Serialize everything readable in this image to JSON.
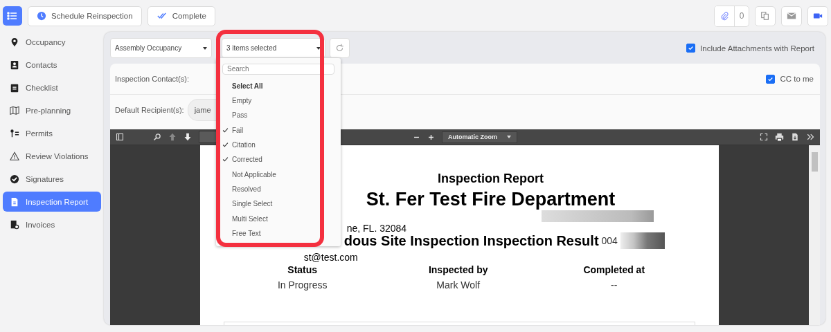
{
  "toolbar": {
    "buttons": [
      {
        "label": "Schedule Reinspection",
        "kind": "clock"
      },
      {
        "label": "Complete",
        "kind": "check"
      }
    ],
    "attachment_count": "0"
  },
  "sidebar": {
    "items": [
      {
        "label": "Occupancy",
        "selected": false
      },
      {
        "label": "Contacts",
        "selected": false
      },
      {
        "label": "Checklist",
        "selected": false
      },
      {
        "label": "Pre-planning",
        "selected": false
      },
      {
        "label": "Permits",
        "selected": false
      },
      {
        "label": "Review Violations",
        "selected": false
      },
      {
        "label": "Signatures",
        "selected": false
      },
      {
        "label": "Inspection Report",
        "selected": true
      },
      {
        "label": "Invoices",
        "selected": false
      }
    ]
  },
  "filters": {
    "occupancy": "Assembly Occupancy",
    "status_select": {
      "value": "3 items selected",
      "expanded": true,
      "search_placeholder": "Search",
      "options": [
        {
          "label": "Select All",
          "kind": "all",
          "checked": false
        },
        {
          "label": "Empty",
          "kind": "option",
          "checked": false
        },
        {
          "label": "Pass",
          "kind": "option",
          "checked": false
        },
        {
          "label": "Fail",
          "kind": "option",
          "checked": true
        },
        {
          "label": "Citation",
          "kind": "option",
          "checked": true
        },
        {
          "label": "Corrected",
          "kind": "option",
          "checked": true
        },
        {
          "label": "Not Applicable",
          "kind": "option",
          "checked": false
        },
        {
          "label": "Resolved",
          "kind": "option",
          "checked": false
        },
        {
          "label": "Single Select",
          "kind": "option",
          "checked": false
        },
        {
          "label": "Multi Select",
          "kind": "option",
          "checked": false
        },
        {
          "label": "Free Text",
          "kind": "option",
          "checked": false
        }
      ]
    }
  },
  "include_attachments": {
    "label": "Include Attachments with Report",
    "checked": true
  },
  "recipients": {
    "contacts_label": "Inspection Contact(s):",
    "cc": {
      "label": "CC to me",
      "checked": true
    },
    "default_label": "Default Recipient(s):",
    "default_value": "jame"
  },
  "viewer": {
    "zoom": "Automatic Zoom",
    "document": {
      "title": "Inspection Report",
      "department": "St. Fer Test Fire Department",
      "address": "ne, FL. 32084",
      "heading": "dous Site Inspection Inspection Result",
      "reference": "004",
      "email": "st@test.com",
      "columns": [
        {
          "heading": "Status",
          "value": "In Progress"
        },
        {
          "heading": "Inspected by",
          "value": "Mark Wolf"
        },
        {
          "heading": "Completed at",
          "value": "--"
        }
      ]
    }
  }
}
